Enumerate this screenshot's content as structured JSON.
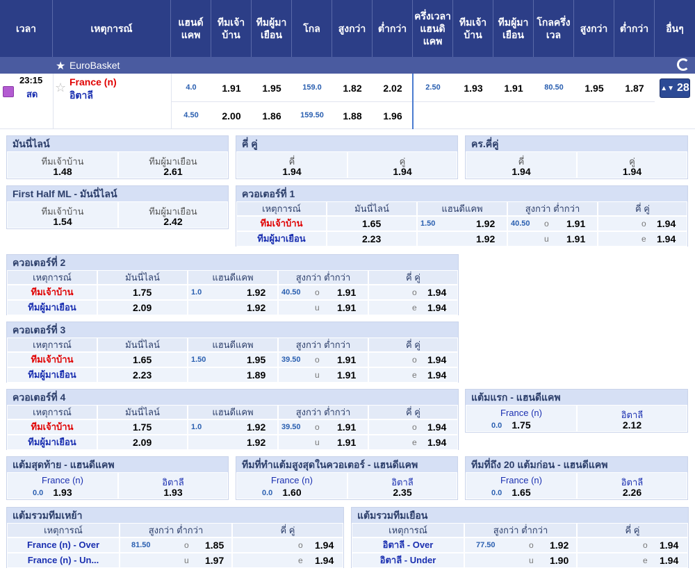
{
  "header": [
    "เวลา",
    "เหตุการณ์",
    "แฮนด์แคพ",
    "ทีมเจ้าบ้าน",
    "ทีมผู้มาเยือน",
    "โกล",
    "สูงกว่า",
    "ต่ำกว่า",
    "ครึ่งเวลาแฮนดิแคพ",
    "ทีมเจ้าบ้าน",
    "ทีมผู้มาเยือน",
    "โกลครึ่งเวล",
    "สูงกว่า",
    "ต่ำกว่า",
    "อื่นๆ"
  ],
  "league": "EuroBasket",
  "match": {
    "time": "23:15",
    "live": "สด",
    "home": "France (n)",
    "away": "อิตาลี",
    "more": "28",
    "row1": {
      "hcp": "4.0",
      "h": "1.91",
      "a": "1.95",
      "goal": "159.0",
      "over": "1.82",
      "under": "2.02",
      "hhcp": "2.50",
      "hh": "1.93",
      "ha": "1.91",
      "hgoal": "80.50",
      "hover": "1.95",
      "hunder": "1.87"
    },
    "row2": {
      "hcp": "4.50",
      "h": "2.00",
      "a": "1.86",
      "goal": "159.50",
      "over": "1.88",
      "under": "1.96"
    }
  },
  "t": {
    "moneyline": "มันนี่ไลน์",
    "oddeven": "คี่ คู่",
    "ht_oddeven": "คร.คี่คู่",
    "home": "ทีมเจ้าบ้าน",
    "away": "ทีมผู้มาเยือน",
    "odd": "คี่",
    "even": "คู่",
    "event": "เหตุการณ์",
    "handicap": "แฮนดีแคพ",
    "ou": "สูงกว่า ต่ำกว่า",
    "o": "o",
    "u": "u",
    "e": "e"
  },
  "ml": {
    "h": "1.48",
    "a": "2.61"
  },
  "oe": {
    "o": "1.94",
    "e": "1.94"
  },
  "htoe": {
    "o": "1.94",
    "e": "1.94"
  },
  "fhml": {
    "title": "First Half ML - มันนี่ไลน์",
    "h": "1.54",
    "a": "2.42"
  },
  "quarters": [
    {
      "title": "ควอเตอร์ที่ 1",
      "hml": "1.65",
      "aml": "2.23",
      "hcp": "1.50",
      "hh": "1.92",
      "ah": "1.92",
      "ou": "40.50",
      "ov": "1.91",
      "uv": "1.91",
      "oo": "1.94",
      "ee": "1.94"
    },
    {
      "title": "ควอเตอร์ที่ 2",
      "hml": "1.75",
      "aml": "2.09",
      "hcp": "1.0",
      "hh": "1.92",
      "ah": "1.92",
      "ou": "40.50",
      "ov": "1.91",
      "uv": "1.91",
      "oo": "1.94",
      "ee": "1.94"
    },
    {
      "title": "ควอเตอร์ที่ 3",
      "hml": "1.65",
      "aml": "2.23",
      "hcp": "1.50",
      "hh": "1.95",
      "ah": "1.89",
      "ou": "39.50",
      "ov": "1.91",
      "uv": "1.91",
      "oo": "1.94",
      "ee": "1.94"
    },
    {
      "title": "ควอเตอร์ที่ 4",
      "hml": "1.75",
      "aml": "2.09",
      "hcp": "1.0",
      "hh": "1.92",
      "ah": "1.92",
      "ou": "39.50",
      "ov": "1.91",
      "uv": "1.91",
      "oo": "1.94",
      "ee": "1.94"
    }
  ],
  "first": {
    "title": "แต้มแรก - แฮนดีแคพ",
    "hcp": "0.0",
    "h": "1.75",
    "a": "2.12"
  },
  "last": {
    "title": "แต้มสุดท้าย - แฮนดีแคพ",
    "hcp": "0.0",
    "h": "1.93",
    "a": "1.93"
  },
  "highq": {
    "title": "ทีมที่ทำแต้มสูงสุดในควอเตอร์ - แฮนดีแคพ",
    "hcp": "0.0",
    "h": "1.60",
    "a": "2.35"
  },
  "first20": {
    "title": "ทีมที่ถึง 20 แต้มก่อน - แฮนดีแคพ",
    "hcp": "0.0",
    "h": "1.65",
    "a": "2.26"
  },
  "hometot": {
    "title": "แต้มรวมทีมเหย้า",
    "over": "France (n) - Over",
    "under": "France (n) - Un...",
    "line": "81.50",
    "ov": "1.85",
    "uv": "1.97",
    "oo": "1.94",
    "ee": "1.94"
  },
  "awaytot": {
    "title": "แต้มรวมทีมเยือน",
    "over": "อิตาลี - Over",
    "under": "อิตาลี - Under",
    "line": "77.50",
    "ov": "1.92",
    "uv": "1.90",
    "oo": "1.94",
    "ee": "1.94"
  }
}
